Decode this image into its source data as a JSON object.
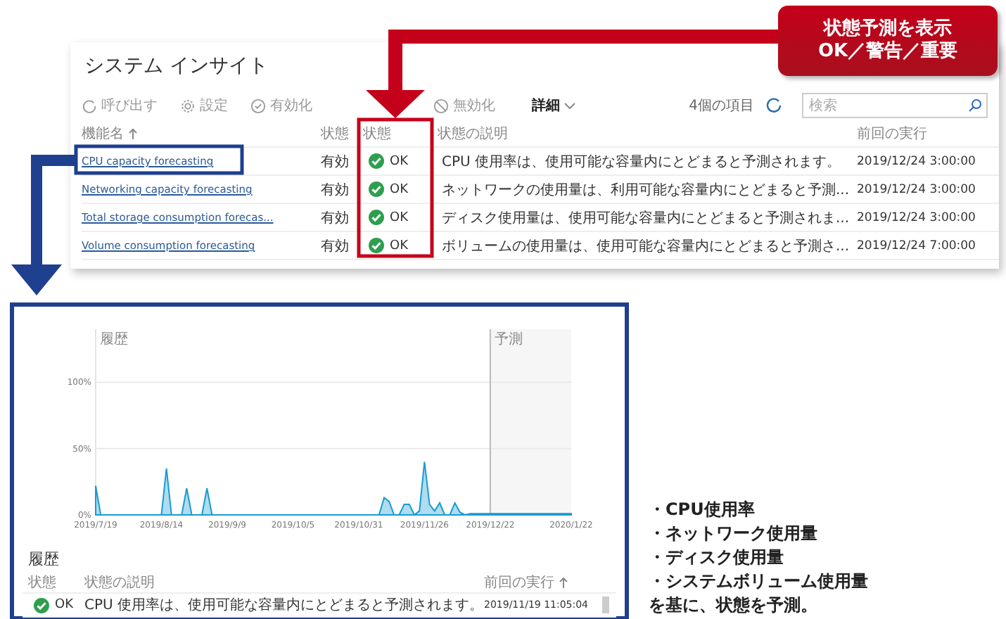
{
  "callout": {
    "lines": [
      "状態予測を表示",
      "OK／警告／重要"
    ]
  },
  "window": {
    "title": "システム インサイト"
  },
  "toolbar": [
    {
      "label": "呼び出す",
      "disabled": true
    },
    {
      "label": "設定",
      "disabled": true
    },
    {
      "label": "有効化",
      "disabled": true
    },
    {
      "label": "無効化",
      "disabled": true
    }
  ],
  "more_menu": "詳細",
  "item_count": "4個の項目",
  "search": {
    "placeholder": "検索"
  },
  "table": {
    "columns": [
      {
        "label": "機能名",
        "sorted": true
      },
      {
        "label": "状態",
        "sorted": false
      },
      {
        "label": "状態",
        "sorted": false
      },
      {
        "label": "状態の説明",
        "sorted": false
      },
      {
        "label": "前回の実行",
        "sorted": false
      }
    ],
    "rows": [
      {
        "name": "CPU capacity forecasting",
        "state": "有効",
        "status": "OK",
        "description": "CPU 使用率は、使用可能な容量内にとどまると予測されます。",
        "last_run": "2019/12/24 3:00:00"
      },
      {
        "name": "Networking capacity forecasting",
        "state": "有効",
        "status": "OK",
        "description": "ネットワークの使用量は、利用可能な容量内にとどまると予測...",
        "last_run": "2019/12/24 3:00:00"
      },
      {
        "name": "Total storage consumption forecas...",
        "state": "有効",
        "status": "OK",
        "description": "ディスク使用量は、使用可能な容量内にとどまると予測されま...",
        "last_run": "2019/12/24 3:00:00"
      },
      {
        "name": "Volume consumption forecasting",
        "state": "有効",
        "status": "OK",
        "description": "ボリュームの使用量は、使用可能な容量内にとどまると予測さ...",
        "last_run": "2019/12/24 7:00:00"
      }
    ]
  },
  "chart": {
    "chart_data": {
      "type": "area",
      "categories": [
        "2019/7/19",
        null,
        null,
        null,
        null,
        null,
        null,
        null,
        null,
        null,
        null,
        null,
        null,
        "2019/8/14",
        null,
        null,
        null,
        null,
        null,
        null,
        null,
        null,
        null,
        null,
        null,
        null,
        "2019/9/9",
        null,
        null,
        null,
        null,
        null,
        null,
        null,
        null,
        null,
        null,
        null,
        null,
        "2019/10/5",
        null,
        null,
        null,
        null,
        null,
        null,
        null,
        null,
        null,
        null,
        null,
        null,
        "2019/10/31",
        null,
        null,
        null,
        null,
        null,
        null,
        null,
        null,
        null,
        null,
        null,
        null,
        "2019/11/26",
        null,
        null,
        null,
        null,
        null,
        null,
        null,
        null,
        null,
        null,
        null,
        null,
        "2019/12/22",
        null,
        null,
        null,
        null,
        null,
        null,
        null,
        null,
        null,
        null,
        null,
        null,
        null,
        null,
        null,
        "2020/1/22"
      ],
      "series": [
        {
          "color": "#1a9bd0",
          "values": [
            22,
            0,
            0,
            0,
            0,
            0,
            0,
            0,
            0,
            0,
            0,
            0,
            0,
            0,
            35,
            0,
            0,
            0,
            20,
            0,
            0,
            0,
            20,
            0,
            0,
            0,
            0,
            0,
            0,
            0,
            0,
            0,
            0,
            0,
            0,
            0,
            0,
            0,
            0,
            0,
            0,
            0,
            0,
            0,
            0,
            0,
            0,
            0,
            0,
            0,
            0,
            0,
            0,
            0,
            0,
            0,
            0,
            13,
            10,
            0,
            0,
            8,
            8,
            0,
            3,
            40,
            8,
            3,
            9,
            0,
            0,
            9,
            2,
            0,
            1,
            1,
            1,
            1,
            1,
            1,
            1,
            1,
            1,
            1,
            1,
            1,
            1,
            1,
            1,
            1,
            1,
            1,
            1,
            1,
            1
          ]
        }
      ],
      "ylim": [
        0,
        140
      ],
      "yticks": [
        {
          "value": 0,
          "label": "0%"
        },
        {
          "value": 50,
          "label": "50%"
        },
        {
          "value": 100,
          "label": "100%"
        }
      ],
      "annotations": [
        "履歴",
        "予測"
      ]
    }
  },
  "history": {
    "title": "履歴",
    "columns": [
      {
        "label": "状態",
        "sorted": false
      },
      {
        "label": "状態の説明",
        "sorted": false
      },
      {
        "label": "前回の実行",
        "sorted": true
      }
    ],
    "rows": [
      {
        "status": "OK",
        "description": "CPU 使用率は、使用可能な容量内にとどまると予測されます。",
        "last_run": "2019/11/19 11:05:04"
      }
    ]
  },
  "notes": {
    "bullets": [
      "・CPU使用率",
      "・ネットワーク使用量",
      "・ディスク使用量",
      "・システムボリューム使用量"
    ],
    "conclusion": "を基に、状態を予測。"
  }
}
